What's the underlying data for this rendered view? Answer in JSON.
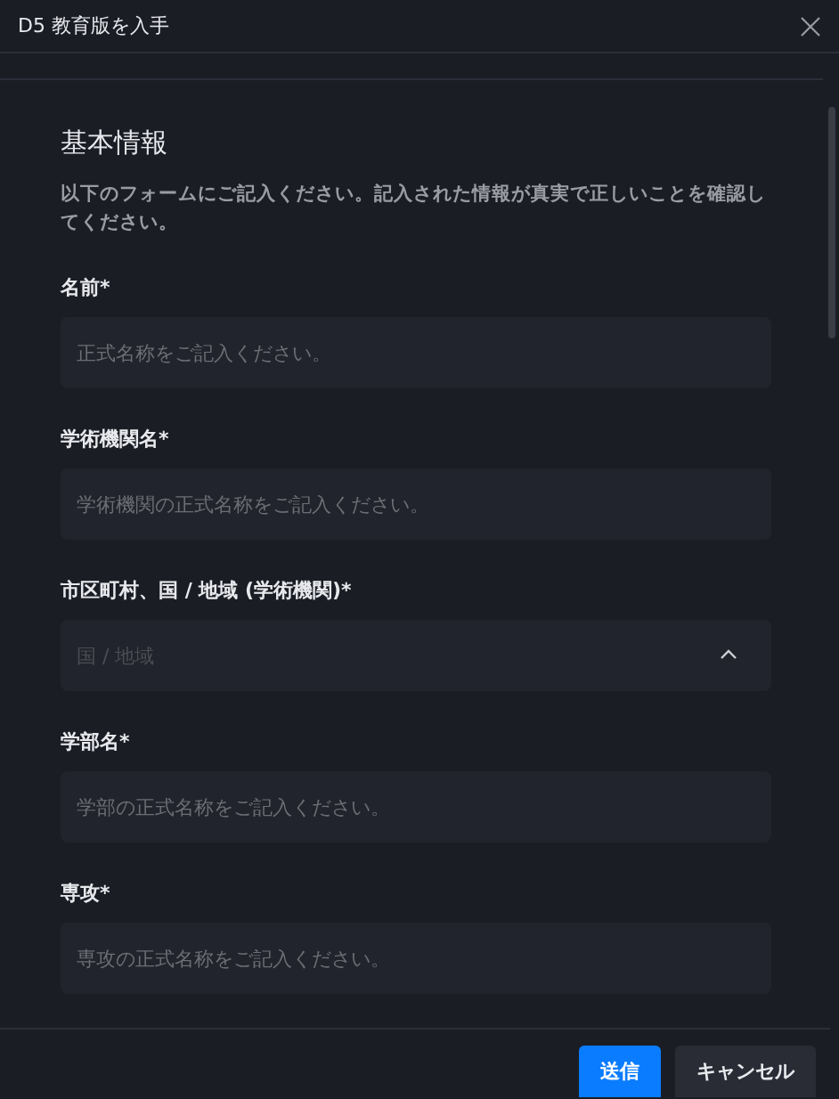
{
  "window": {
    "title": "D5 教育版を入手"
  },
  "section": {
    "heading": "基本情報",
    "description": "以下のフォームにご記入ください。記入された情報が真実で正しいことを確認してください。"
  },
  "fields": [
    {
      "kind": "text",
      "label": "名前*",
      "placeholder": "正式名称をご記入ください。"
    },
    {
      "kind": "text",
      "label": "学術機関名*",
      "placeholder": "学術機関の正式名称をご記入ください。"
    },
    {
      "kind": "select",
      "label": "市区町村、国 / 地域 (学術機関)*",
      "placeholder": "国 / 地域"
    },
    {
      "kind": "text",
      "label": "学部名*",
      "placeholder": "学部の正式名称をご記入ください。"
    },
    {
      "kind": "text",
      "label": "専攻*",
      "placeholder": "専攻の正式名称をご記入ください。"
    }
  ],
  "buttons": [
    {
      "label": "送信",
      "kind": "primary"
    },
    {
      "label": "キャンセル",
      "kind": "secondary"
    }
  ]
}
